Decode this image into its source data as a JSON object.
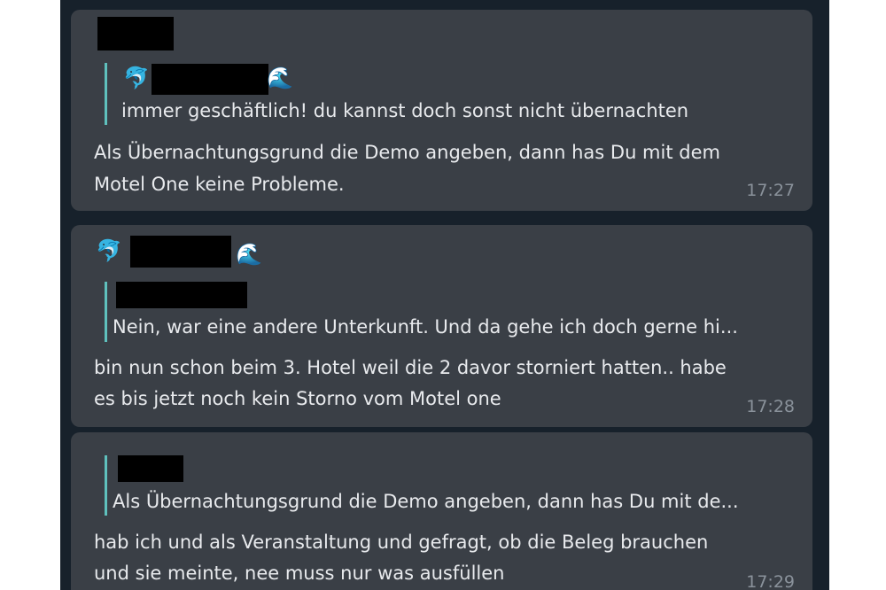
{
  "messages": [
    {
      "quote": {
        "icon_left": "dolphin-icon",
        "icon_right": "wave-icon",
        "text": "immer geschäftlich! du kannst doch sonst nicht übernachten"
      },
      "lines": [
        "Als Übernachtungsgrund die Demo angeben, dann has Du mit dem",
        "Motel One keine Probleme."
      ],
      "time": "17:27"
    },
    {
      "sender_icons": [
        "dolphin-icon",
        "wave-icon"
      ],
      "quote": {
        "text": "Nein, war eine andere Unterkunft. Und da gehe ich doch gerne hi..."
      },
      "lines": [
        "bin nun schon beim 3. Hotel weil die 2 davor storniert hatten.. habe",
        "es bis jetzt noch kein Storno vom Motel one"
      ],
      "time": "17:28"
    },
    {
      "quote": {
        "text": "Als Übernachtungsgrund die Demo angeben, dann has Du mit de..."
      },
      "lines": [
        "hab ich und als Veranstaltung und gefragt, ob die Beleg brauchen",
        "und sie meinte, nee muss nur was ausfüllen"
      ],
      "time": "17:29"
    }
  ],
  "colors": {
    "background": "#17212b",
    "bubble": "#3a3f46",
    "quote_bar": "#5fc0bd",
    "text": "#e8eaed",
    "time": "#8a929b"
  },
  "glyphs": {
    "dolphin": "🐬",
    "wave": "🌊"
  }
}
